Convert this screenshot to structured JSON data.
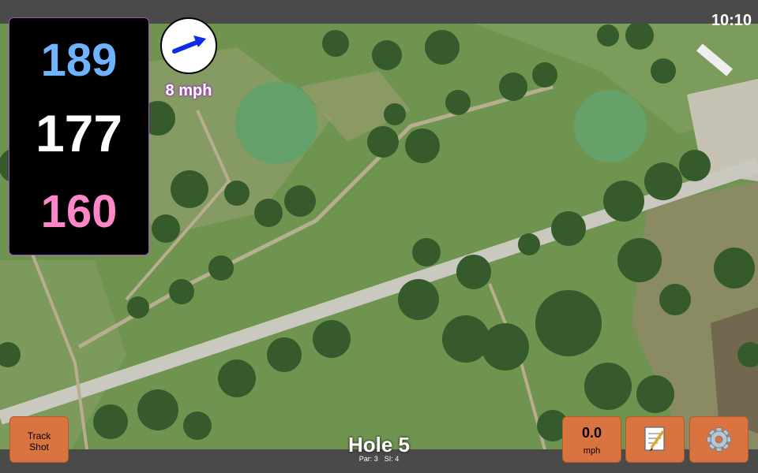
{
  "status": {
    "clock": "10:10"
  },
  "distances": {
    "back": "189",
    "middle": "177",
    "front": "160"
  },
  "wind": {
    "speed": "8 mph",
    "icon": "wind-arrow-icon"
  },
  "hole": {
    "title": "Hole 5",
    "par": "Par: 3",
    "si": "SI: 4"
  },
  "buttons": {
    "track_line1": "Track",
    "track_line2": "Shot",
    "speed_value": "0.0",
    "speed_unit": "mph",
    "notes_icon": "notepad-icon",
    "settings_icon": "gear-icon"
  },
  "colors": {
    "accent": "#d9733f",
    "back_yardage": "#6fb3ff",
    "front_yardage": "#ff86c8",
    "panel_border": "#a44bd0"
  }
}
